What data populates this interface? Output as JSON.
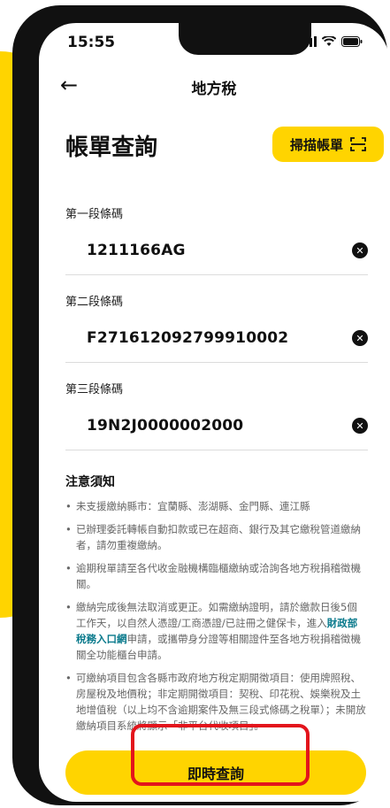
{
  "status_bar": {
    "time": "15:55"
  },
  "nav": {
    "title": "地方稅"
  },
  "page": {
    "title": "帳單查詢",
    "scan_label": "掃描帳單"
  },
  "fields": [
    {
      "label": "第一段條碼",
      "value": "1211166AG"
    },
    {
      "label": "第二段條碼",
      "value": "F271612092799910002"
    },
    {
      "label": "第三段條碼",
      "value": "19N2J0000002000"
    }
  ],
  "notes": {
    "title": "注意須知",
    "items": [
      "未支援繳納縣市：宜蘭縣、澎湖縣、金門縣、連江縣",
      "已辦理委託轉帳自動扣款或已在超商、銀行及其它繳稅管道繳納者，請勿重複繳納。",
      "逾期稅單請至各代收金融機構臨櫃繳納或洽詢各地方稅捐稽徵機關。",
      {
        "pre": "繳納完成後無法取消或更正。如需繳納證明，請於繳款日後5個工作天，以自然人憑證/工商憑證/已註冊之健保卡，進入",
        "link": "財政部稅務入口網",
        "post": "申請，或攜帶身分證等相關證件至各地方稅捐稽徵機關全功能櫃台申請。"
      },
      "可繳納項目包含各縣市政府地方稅定期開徵項目：使用牌照稅、房屋稅及地價稅；非定期開徵項目：契稅、印花稅、娛樂稅及土地增值稅（以上均不含逾期案件及無三段式條碼之稅單）；未開放繳納項目系統將顯示「非平台代收項目」。"
    ]
  },
  "actions": {
    "query_label": "即時查詢"
  },
  "colors": {
    "accent": "#FFD400",
    "highlight": "#E3141C",
    "link": "#0A7A8C"
  },
  "icons": [
    "back-arrow-icon",
    "scan-icon",
    "clear-icon",
    "signal-icon",
    "wifi-icon",
    "battery-icon"
  ]
}
